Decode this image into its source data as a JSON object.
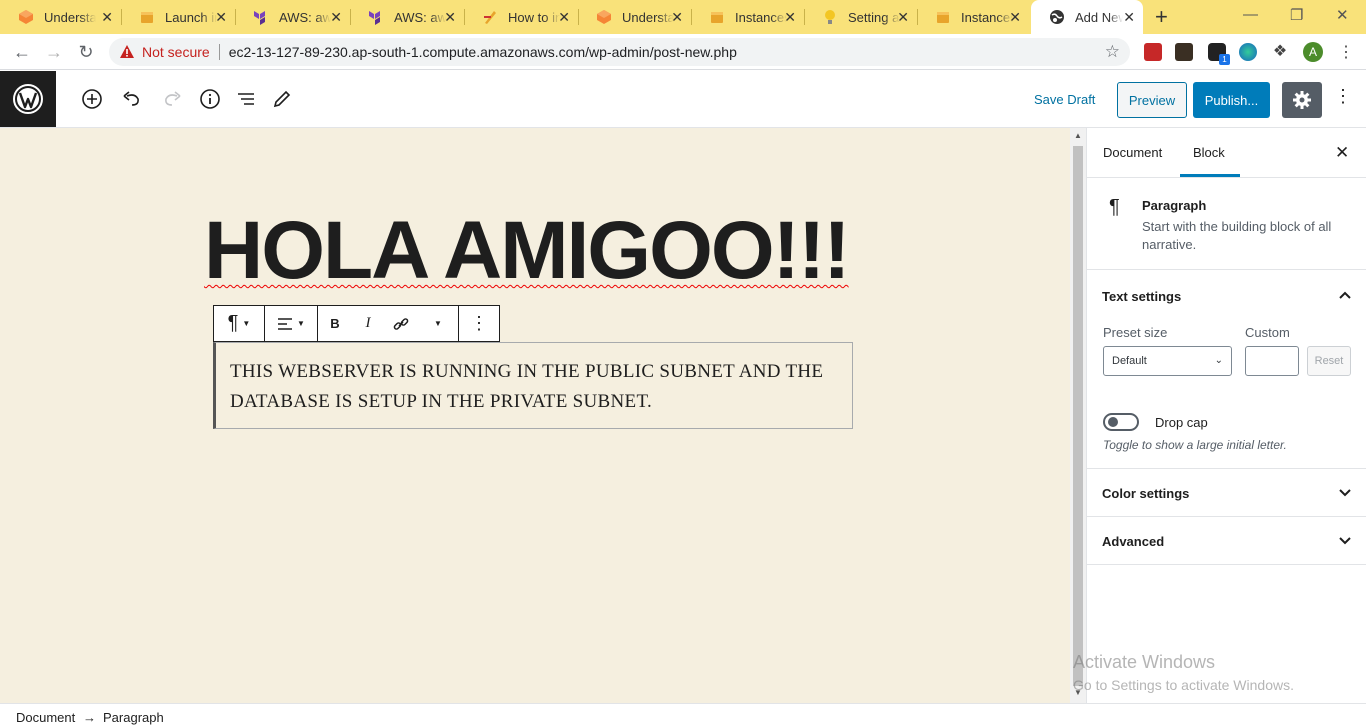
{
  "browser": {
    "tabs": [
      {
        "title": "Understa",
        "icon": "aws-icon"
      },
      {
        "title": "Launch in",
        "icon": "aws-box-icon"
      },
      {
        "title": "AWS: aws",
        "icon": "terraform-icon"
      },
      {
        "title": "AWS: aws",
        "icon": "terraform-icon"
      },
      {
        "title": "How to in",
        "icon": "article-icon"
      },
      {
        "title": "Understa",
        "icon": "aws-icon"
      },
      {
        "title": "Instances",
        "icon": "aws-box-icon"
      },
      {
        "title": "Setting a",
        "icon": "bulb-icon"
      },
      {
        "title": "Instances",
        "icon": "aws-box-icon"
      },
      {
        "title": "Add New",
        "icon": "globe-icon"
      }
    ],
    "close_glyph": "✕",
    "new_tab_glyph": "+",
    "security_label": "Not secure",
    "url": "ec2-13-127-89-230.ap-south-1.compute.amazonaws.com/wp-admin/post-new.php",
    "profile_initial": "A",
    "extension_badge": "1"
  },
  "editor": {
    "save_draft_label": "Save Draft",
    "preview_label": "Preview",
    "publish_label": "Publish...",
    "post_title": "HOLA AMIGOO!!!",
    "paragraph": "THIS WEBSERVER IS RUNNING IN THE PUBLIC SUBNET AND THE DATABASE IS SETUP IN THE PRIVATE SUBNET."
  },
  "sidebar": {
    "tab_document": "Document",
    "tab_block": "Block",
    "block_name": "Paragraph",
    "block_description": "Start with the building block of all narrative.",
    "text_settings_title": "Text settings",
    "preset_size_label": "Preset size",
    "preset_size_value": "Default",
    "custom_label": "Custom",
    "reset_label": "Reset",
    "drop_cap_label": "Drop cap",
    "drop_cap_help": "Toggle to show a large initial letter.",
    "color_settings_title": "Color settings",
    "advanced_title": "Advanced"
  },
  "watermark": {
    "line1": "Activate Windows",
    "line2": "Go to Settings to activate Windows."
  },
  "footer": {
    "crumb_document": "Document",
    "arrow": "→",
    "crumb_paragraph": "Paragraph"
  },
  "colors": {
    "tabstrip": "#f9e27a",
    "canvas": "#f5efdf",
    "accent": "#007cba",
    "wp_dark": "#1e1e1e"
  }
}
